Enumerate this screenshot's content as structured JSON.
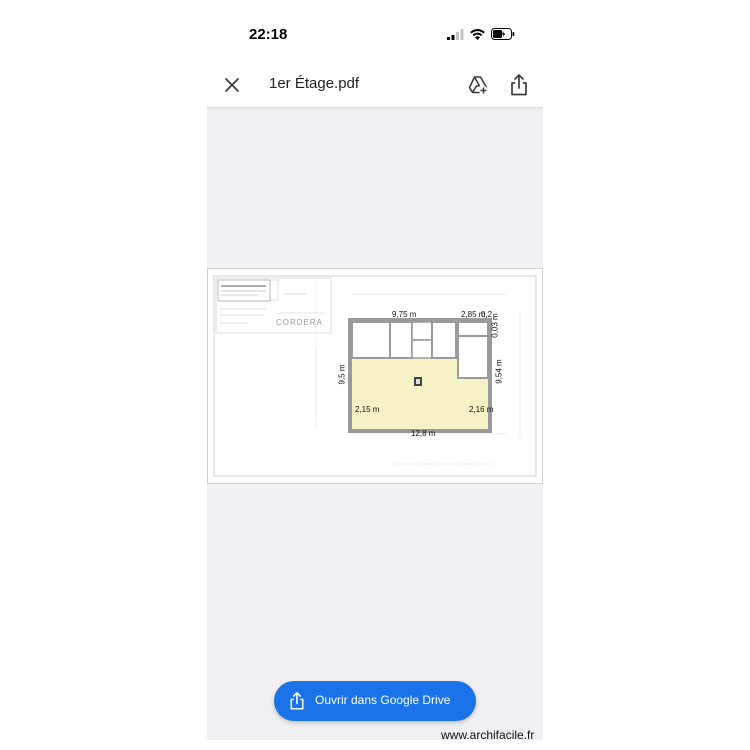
{
  "status_bar": {
    "time": "22:18",
    "icons": [
      "cellular-signal-icon",
      "wifi-icon",
      "battery-icon"
    ]
  },
  "header": {
    "title": "1er Étage.pdf",
    "icons": [
      "close-icon",
      "add-to-drive-icon",
      "share-icon"
    ]
  },
  "document": {
    "titleblock_text": "CORDERA",
    "dimensions": {
      "top_left": "9,75 m",
      "top_right": "2,85 m",
      "top_right_small": "0,2",
      "left": "9,5 m",
      "right": "9,54 m",
      "right_small": "0,03 m",
      "inner_left": "2,15 m",
      "inner_right": "2,16 m",
      "bottom": "12,8 m"
    }
  },
  "open_drive_button": {
    "label": "Ouvrir dans Google Drive",
    "icon": "share-icon"
  },
  "watermark": "www.archifacile.fr",
  "colors": {
    "accent": "#1a73e8",
    "viewer_bg": "#f0eff4",
    "plan_fill": "#f7f2c6",
    "wall": "#9a9a9a"
  }
}
